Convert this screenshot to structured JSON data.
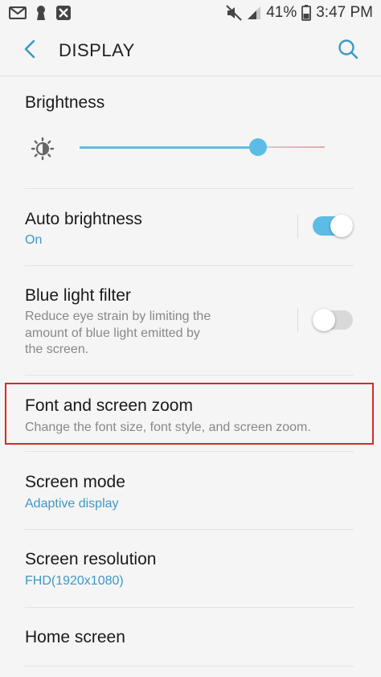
{
  "status_bar": {
    "battery": "41%",
    "time": "3:47 PM",
    "left_icons": [
      "gmail-icon",
      "keyhole-icon",
      "flipboard-icon"
    ],
    "right_icons": [
      "mute-icon",
      "signal-icon",
      "battery-icon"
    ]
  },
  "app_bar": {
    "title": "DISPLAY",
    "back_icon": "chevron-left-icon",
    "search_icon": "search-icon"
  },
  "brightness": {
    "label": "Brightness",
    "icon": "brightness-icon",
    "value_fraction": 0.727
  },
  "auto_brightness": {
    "title": "Auto brightness",
    "status": "On",
    "enabled": true
  },
  "blue_light_filter": {
    "title": "Blue light filter",
    "description_lines": [
      "Reduce eye strain by limiting the",
      "amount of blue light emitted by",
      "the screen."
    ],
    "enabled": false
  },
  "font_and_screen_zoom": {
    "title": "Font and screen zoom",
    "description": "Change the font size, font style, and screen zoom."
  },
  "screen_mode": {
    "title": "Screen mode",
    "value": "Adaptive display"
  },
  "screen_resolution": {
    "title": "Screen resolution",
    "value": "FHD(1920x1080)"
  },
  "home_screen": {
    "title": "Home screen"
  },
  "colors": {
    "accent": "#3f98c4",
    "slider": "#5bbde5",
    "highlight": "#d42a2a"
  }
}
